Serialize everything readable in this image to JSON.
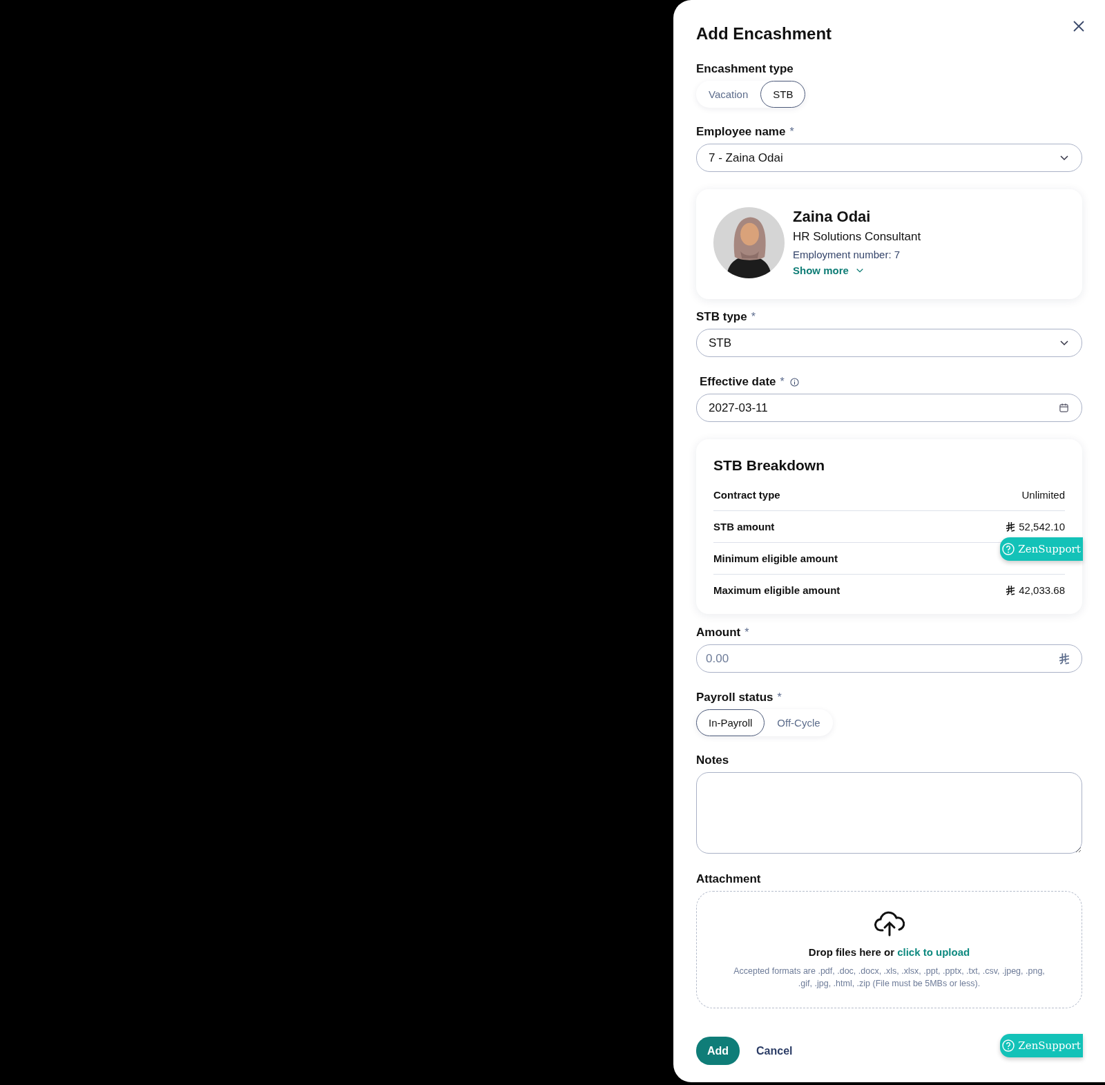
{
  "dialog": {
    "title": "Add Encashment"
  },
  "encashment_type": {
    "label": "Encashment type",
    "options": [
      {
        "label": "Vacation",
        "selected": false
      },
      {
        "label": "STB",
        "selected": true
      }
    ]
  },
  "employee_name": {
    "label": "Employee name",
    "required_mark": "*",
    "value": "7 - Zaina Odai"
  },
  "employee_card": {
    "name": "Zaina Odai",
    "position": "HR Solutions Consultant",
    "employment_number": "Employment number: 7",
    "show_more": "Show more"
  },
  "stb_type": {
    "label": "STB type",
    "required_mark": "*",
    "value": "STB"
  },
  "effective_date": {
    "label": "Effective date",
    "required_mark": "*",
    "value": "2027-03-11"
  },
  "breakdown": {
    "title": "STB Breakdown",
    "rows": [
      {
        "label": "Contract type",
        "kind": "text",
        "value": "Unlimited"
      },
      {
        "label": "STB amount",
        "kind": "currency",
        "value": "52,542.10"
      },
      {
        "label": "Minimum eligible amount",
        "kind": "hidden"
      },
      {
        "label": "Maximum eligible amount",
        "kind": "currency",
        "value": "42,033.68"
      }
    ]
  },
  "amount": {
    "label": "Amount",
    "required_mark": "*",
    "placeholder": "0.00"
  },
  "payroll_status": {
    "label": "Payroll status",
    "required_mark": "*",
    "options": [
      {
        "label": "In-Payroll",
        "selected": true
      },
      {
        "label": "Off-Cycle",
        "selected": false
      }
    ]
  },
  "notes": {
    "label": "Notes"
  },
  "attachment": {
    "label": "Attachment",
    "prompt": "Drop files here or",
    "link": "click to upload",
    "hint": "Accepted formats are .pdf, .doc, .docx, .xls, .xlsx, .ppt, .pptx, .txt, .csv, .jpeg, .png, .gif, .jpg, .html, .zip (File must be 5MBs or less)."
  },
  "actions": [
    {
      "label": "Add",
      "kind": "primary"
    },
    {
      "label": "Cancel",
      "kind": "link"
    }
  ],
  "support_buttons": [
    {
      "label": "ZenSupport"
    },
    {
      "label": "ZenSupport"
    }
  ]
}
